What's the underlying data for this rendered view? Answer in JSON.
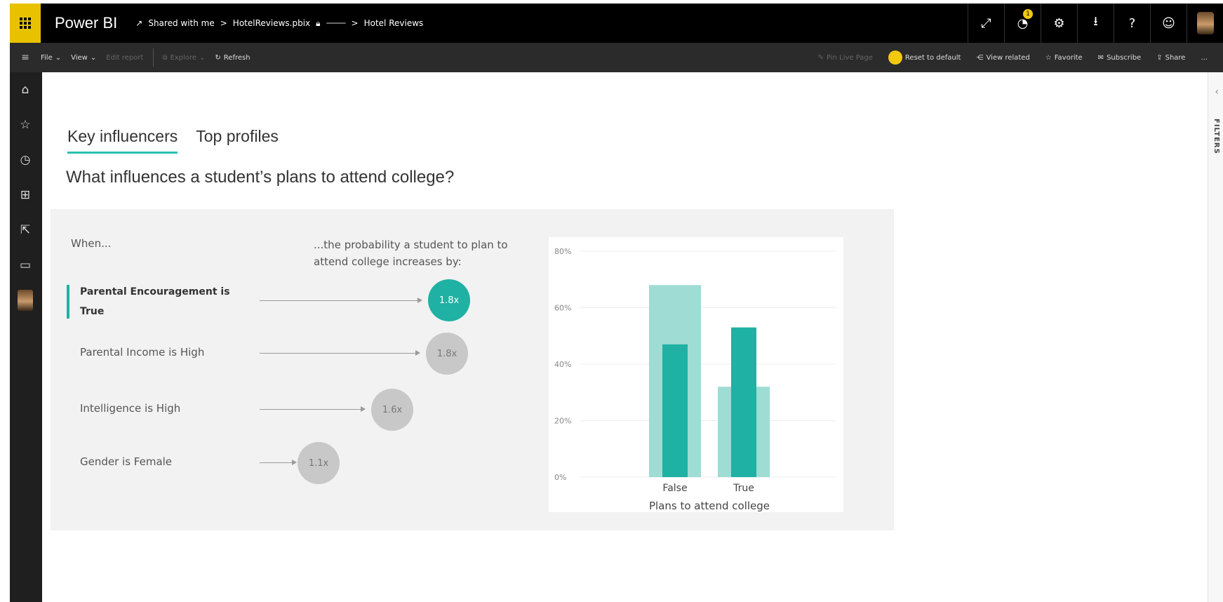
{
  "app": {
    "brand": "Power BI",
    "breadcrumb": {
      "shared": "Shared with me",
      "sep1": ">",
      "file": "HotelReviews.pbix",
      "pill": "",
      "sep2": ">",
      "page": "Hotel Reviews"
    },
    "notification_count": "1"
  },
  "toolbar": {
    "file": "File",
    "view": "View",
    "edit_report": "Edit report",
    "explore": "Explore",
    "refresh": "Refresh",
    "pin_live_page": "Pin Live Page",
    "reset_to_default": "Reset to default",
    "view_related": "View related",
    "favorite": "Favorite",
    "subscribe": "Subscribe",
    "share": "Share",
    "more": "..."
  },
  "filters_pane": {
    "label": "FILTERS"
  },
  "report": {
    "tabs": [
      {
        "label": "Key influencers",
        "active": true
      },
      {
        "label": "Top profiles",
        "active": false
      }
    ],
    "question": "What influences a student’s plans to attend college?",
    "when_label": "When...",
    "probability_label": "...the probability a student to plan to attend college increases by:",
    "influencers": [
      {
        "label": "Parental Encouragement is True",
        "value": "1.8x",
        "selected": true
      },
      {
        "label": "Parental Income is High",
        "value": "1.8x",
        "selected": false
      },
      {
        "label": "Intelligence is High",
        "value": "1.6x",
        "selected": false
      },
      {
        "label": "Gender is Female",
        "value": "1.1x",
        "selected": false
      }
    ]
  },
  "colors": {
    "accent": "#1fb1a3",
    "accent_light": "#9fdcd4",
    "brand_yellow": "#f2c811",
    "bubble_grey": "#c8c8c8"
  },
  "chart_data": {
    "type": "bar",
    "xlabel": "Plans to attend college",
    "ylabel": "",
    "categories": [
      "False",
      "True"
    ],
    "ylim": [
      0,
      80
    ],
    "yticks": [
      "0%",
      "20%",
      "40%",
      "60%",
      "80%"
    ],
    "series": [
      {
        "values": [
          68,
          32
        ]
      },
      {
        "values": [
          47,
          53
        ]
      }
    ],
    "grid": true
  }
}
